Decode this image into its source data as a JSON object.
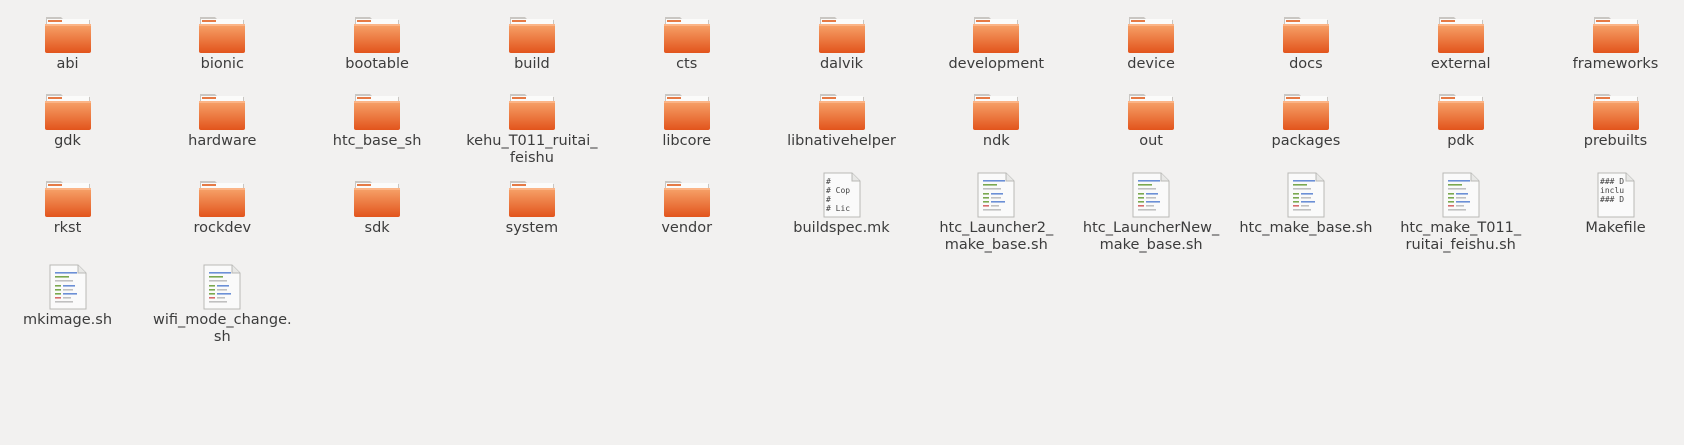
{
  "colors": {
    "folder_top": "#f7a36a",
    "folder_bottom": "#e2541c",
    "background": "#f2f1f0",
    "text": "#3c3c3c"
  },
  "items": [
    {
      "name": "abi",
      "type": "folder"
    },
    {
      "name": "bionic",
      "type": "folder"
    },
    {
      "name": "bootable",
      "type": "folder"
    },
    {
      "name": "build",
      "type": "folder"
    },
    {
      "name": "cts",
      "type": "folder"
    },
    {
      "name": "dalvik",
      "type": "folder"
    },
    {
      "name": "development",
      "type": "folder"
    },
    {
      "name": "device",
      "type": "folder"
    },
    {
      "name": "docs",
      "type": "folder"
    },
    {
      "name": "external",
      "type": "folder"
    },
    {
      "name": "frameworks",
      "type": "folder"
    },
    {
      "name": "gdk",
      "type": "folder"
    },
    {
      "name": "hardware",
      "type": "folder"
    },
    {
      "name": "htc_base_sh",
      "type": "folder"
    },
    {
      "name": "kehu_T011_ruitai_\nfeishu",
      "type": "folder"
    },
    {
      "name": "libcore",
      "type": "folder"
    },
    {
      "name": "libnativehelper",
      "type": "folder"
    },
    {
      "name": "ndk",
      "type": "folder"
    },
    {
      "name": "out",
      "type": "folder"
    },
    {
      "name": "packages",
      "type": "folder"
    },
    {
      "name": "pdk",
      "type": "folder"
    },
    {
      "name": "prebuilts",
      "type": "folder"
    },
    {
      "name": "rkst",
      "type": "folder"
    },
    {
      "name": "rockdev",
      "type": "folder"
    },
    {
      "name": "sdk",
      "type": "folder"
    },
    {
      "name": "system",
      "type": "folder"
    },
    {
      "name": "vendor",
      "type": "folder"
    },
    {
      "name": "buildspec.mk",
      "type": "text",
      "preview": [
        "#",
        "# Cop",
        "#",
        "# Lic"
      ]
    },
    {
      "name": "htc_Launcher2_\nmake_base.sh",
      "type": "script"
    },
    {
      "name": "htc_LauncherNew_\nmake_base.sh",
      "type": "script"
    },
    {
      "name": "htc_make_base.sh",
      "type": "script"
    },
    {
      "name": "htc_make_T011_\nruitai_feishu.sh",
      "type": "script"
    },
    {
      "name": "Makefile",
      "type": "text",
      "preview": [
        "### D",
        "inclu",
        "### D"
      ]
    },
    {
      "name": "mkimage.sh",
      "type": "script"
    },
    {
      "name": "wifi_mode_change.\nsh",
      "type": "script"
    }
  ]
}
